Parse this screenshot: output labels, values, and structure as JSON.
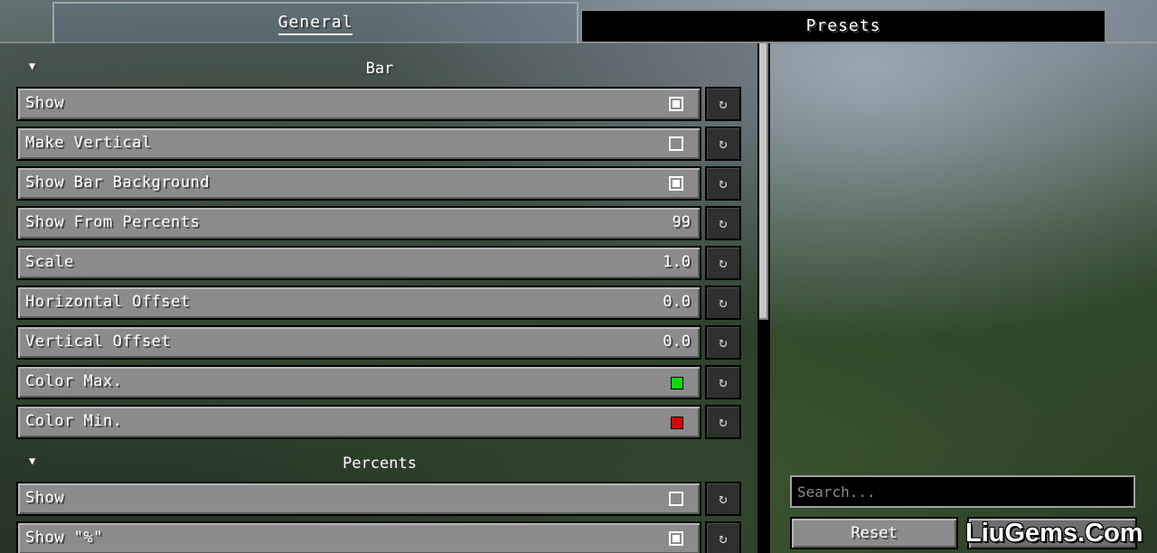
{
  "tabs": {
    "general": "General",
    "presets": "Presets"
  },
  "sections": [
    {
      "title": "Bar",
      "options": [
        {
          "label": "Show",
          "type": "checkbox",
          "checked": true
        },
        {
          "label": "Make Vertical",
          "type": "checkbox",
          "checked": false
        },
        {
          "label": "Show Bar Background",
          "type": "checkbox",
          "checked": true
        },
        {
          "label": "Show From Percents",
          "type": "value",
          "value": "99"
        },
        {
          "label": "Scale",
          "type": "value",
          "value": "1.0"
        },
        {
          "label": "Horizontal Offset",
          "type": "value",
          "value": "0.0"
        },
        {
          "label": "Vertical Offset",
          "type": "value",
          "value": "0.0"
        },
        {
          "label": "Color Max.",
          "type": "color",
          "color": "#00e000"
        },
        {
          "label": "Color Min.",
          "type": "color",
          "color": "#e00000"
        }
      ]
    },
    {
      "title": "Percents",
      "options": [
        {
          "label": "Show",
          "type": "checkbox",
          "checked": false
        },
        {
          "label": "Show \"%\"",
          "type": "checkbox",
          "checked": true
        }
      ]
    }
  ],
  "reset_icon": "reset-arrow-icon",
  "collapse_icon": "triangle-down-icon",
  "search": {
    "placeholder": "Search..."
  },
  "buttons": {
    "reset": "Reset"
  },
  "watermark": "LiuGems.Com"
}
